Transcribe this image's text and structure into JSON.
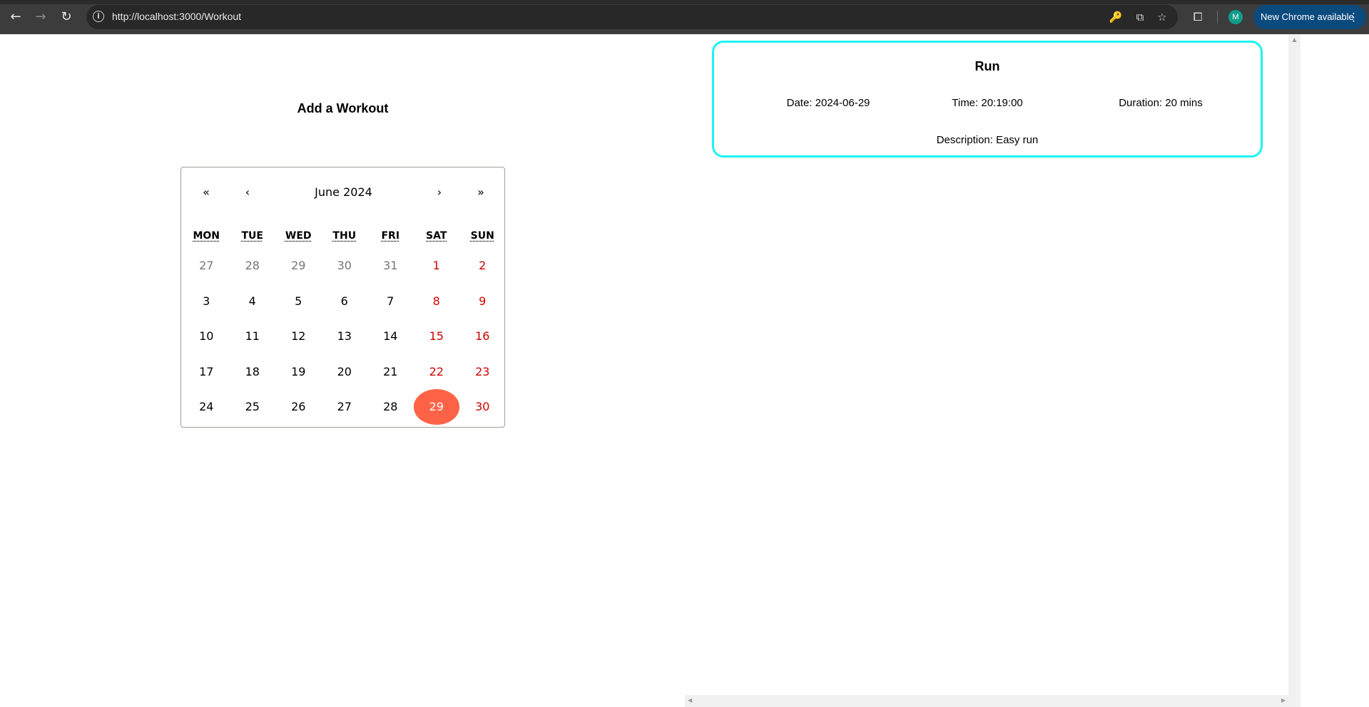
{
  "browser": {
    "url": "http://localhost:3000/Workout",
    "back_icon": "←",
    "forward_icon": "→",
    "reload_icon": "↻",
    "info_icon": "i",
    "password_icon": "🔑",
    "install_icon": "⧉",
    "star_icon": "☆",
    "extensions_icon": "⧠",
    "profile_initial": "M",
    "update_label": "New Chrome available",
    "menu_icon": "⋮"
  },
  "page": {
    "title": "Add a Workout"
  },
  "calendar": {
    "prev2": "«",
    "prev": "‹",
    "month_label": "June 2024",
    "next": "›",
    "next2": "»",
    "weekdays": [
      "MON",
      "TUE",
      "WED",
      "THU",
      "FRI",
      "SAT",
      "SUN"
    ],
    "weeks": [
      [
        "27",
        "28",
        "29",
        "30",
        "31",
        "1",
        "2"
      ],
      [
        "3",
        "4",
        "5",
        "6",
        "7",
        "8",
        "9"
      ],
      [
        "10",
        "11",
        "12",
        "13",
        "14",
        "15",
        "16"
      ],
      [
        "17",
        "18",
        "19",
        "20",
        "21",
        "22",
        "23"
      ],
      [
        "24",
        "25",
        "26",
        "27",
        "28",
        "29",
        "30"
      ]
    ],
    "selected": "29"
  },
  "workout": {
    "title": "Run",
    "date": "Date: 2024-06-29",
    "time": "Time: 20:19:00",
    "duration": "Duration: 20 mins",
    "description": "Description: Easy run",
    "border_color": "#1ff2f2"
  },
  "colors": {
    "selected_day": "#ff6347",
    "weekend": "#d10000",
    "muted": "#757575"
  }
}
